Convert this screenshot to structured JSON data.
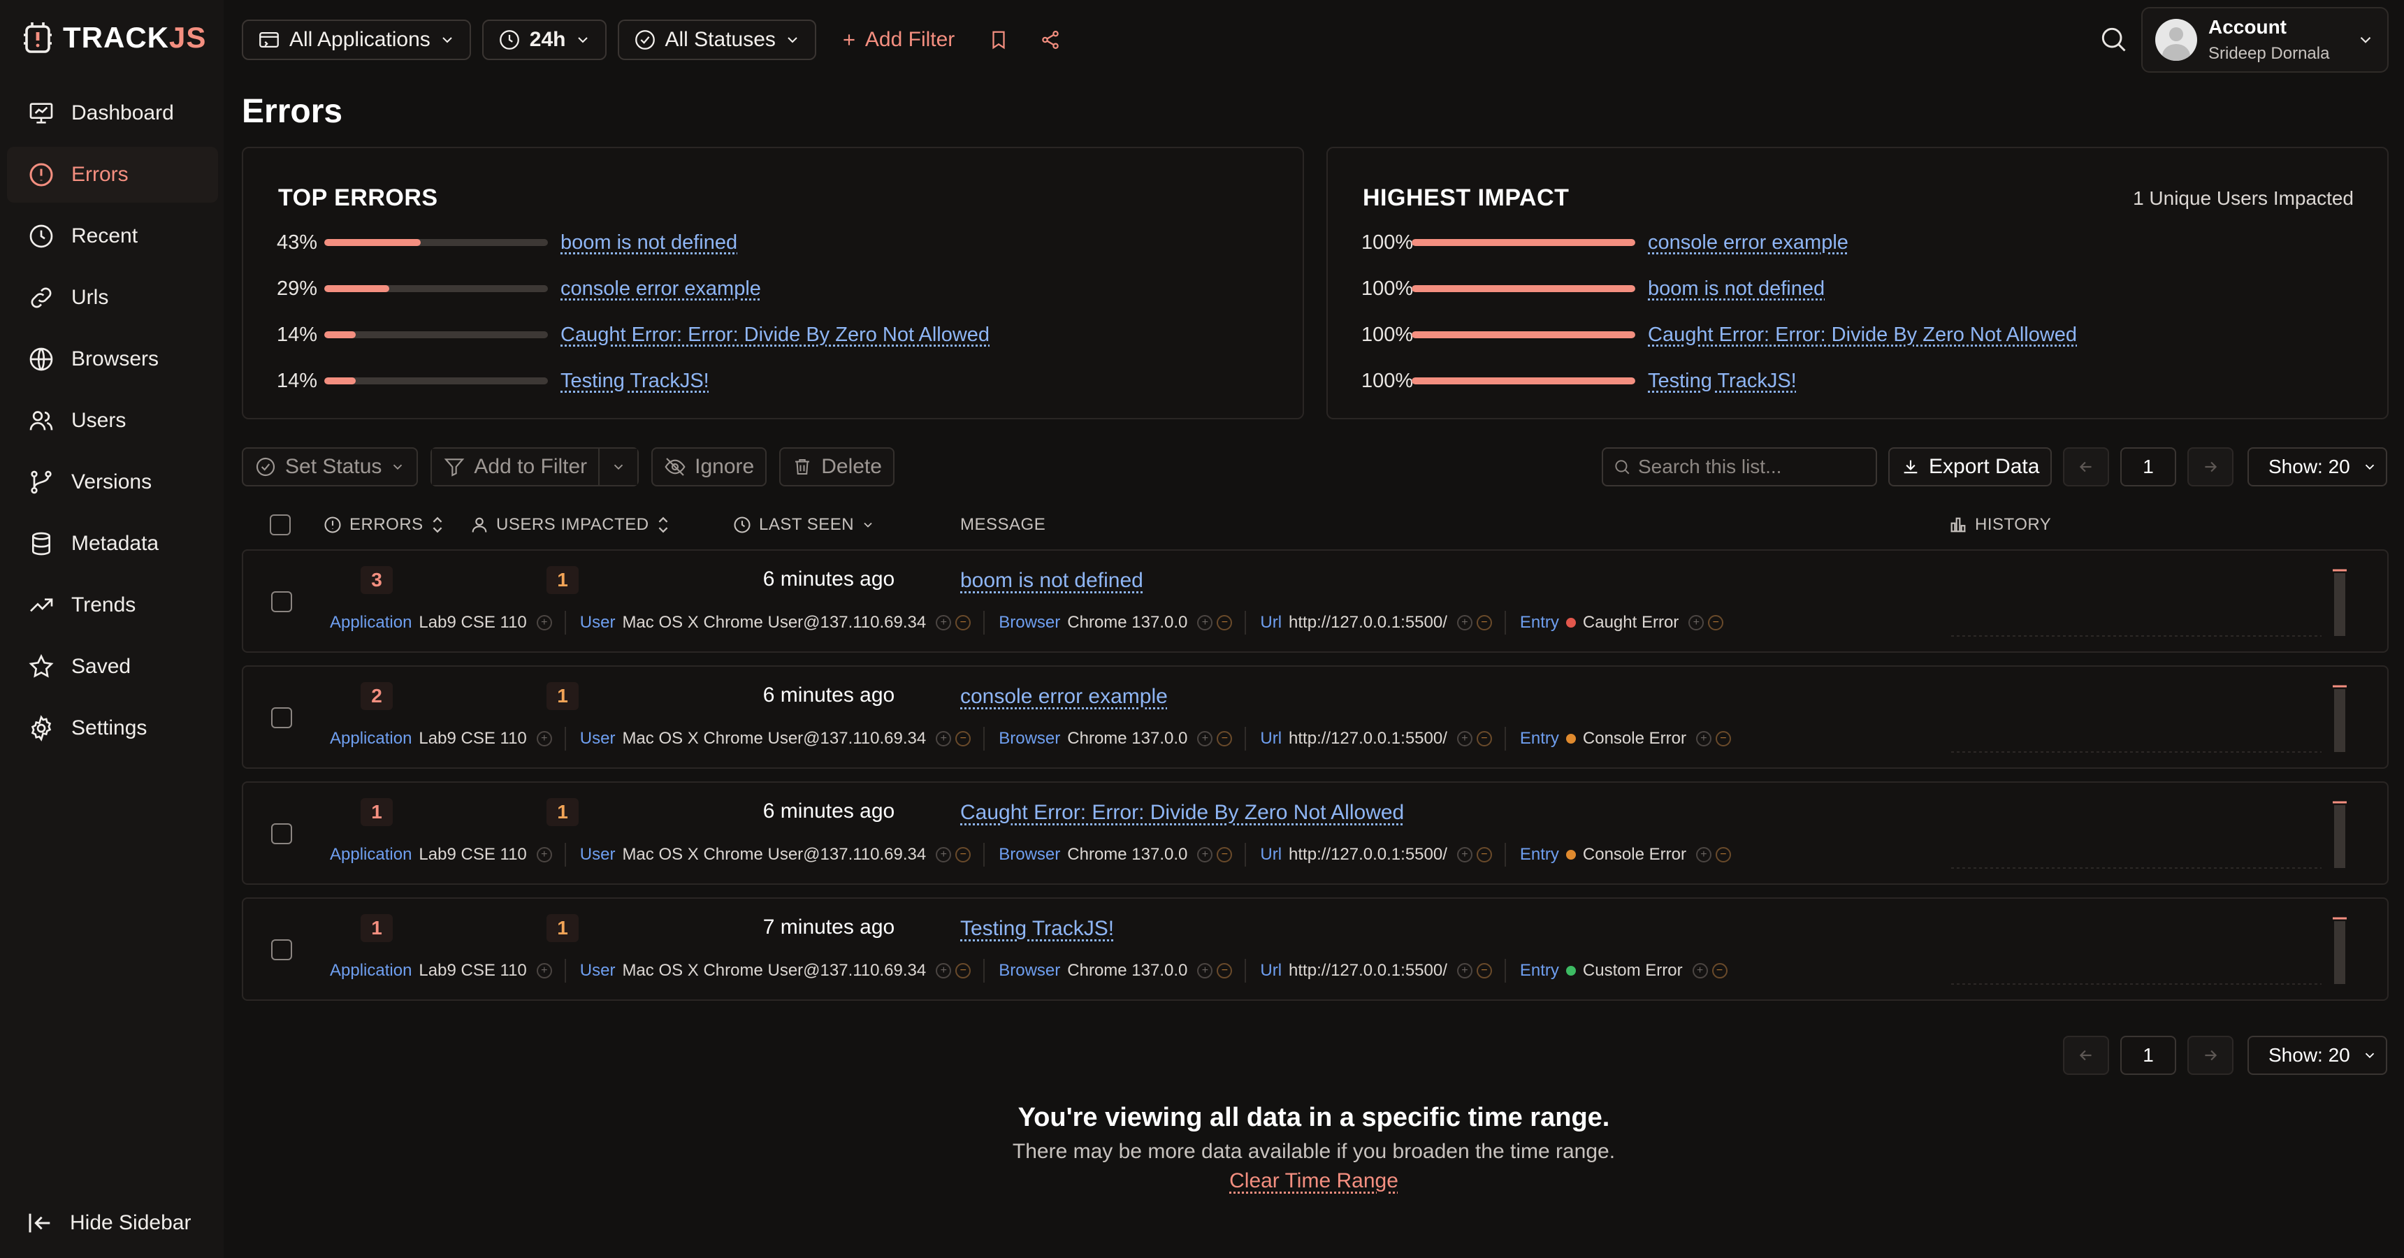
{
  "brand": {
    "logo_main": "TRACK",
    "logo_accent": "JS"
  },
  "sidebar": {
    "items": [
      {
        "label": "Dashboard",
        "icon": "dashboard-icon"
      },
      {
        "label": "Errors",
        "icon": "alert-circle-icon"
      },
      {
        "label": "Recent",
        "icon": "clock-icon"
      },
      {
        "label": "Urls",
        "icon": "link-icon"
      },
      {
        "label": "Browsers",
        "icon": "globe-icon"
      },
      {
        "label": "Users",
        "icon": "users-icon"
      },
      {
        "label": "Versions",
        "icon": "branch-icon"
      },
      {
        "label": "Metadata",
        "icon": "database-icon"
      },
      {
        "label": "Trends",
        "icon": "trend-icon"
      },
      {
        "label": "Saved",
        "icon": "star-icon"
      },
      {
        "label": "Settings",
        "icon": "gear-icon"
      }
    ],
    "active": "Errors",
    "hide_label": "Hide Sidebar"
  },
  "topbar": {
    "applications": "All Applications",
    "range": "24h",
    "statuses": "All Statuses",
    "add_filter": "Add Filter"
  },
  "account": {
    "title": "Account",
    "name": "Srideep Dornala"
  },
  "page_title": "Errors",
  "top_errors": {
    "title": "TOP ERRORS",
    "items": [
      {
        "pct": "43%",
        "value": 0.43,
        "label": "boom is not defined"
      },
      {
        "pct": "29%",
        "value": 0.29,
        "label": "console error example"
      },
      {
        "pct": "14%",
        "value": 0.14,
        "label": "Caught Error: Error: Divide By Zero Not Allowed"
      },
      {
        "pct": "14%",
        "value": 0.14,
        "label": "Testing TrackJS!"
      }
    ]
  },
  "highest_impact": {
    "title": "HIGHEST IMPACT",
    "note": "1 Unique Users Impacted",
    "items": [
      {
        "pct": "100%",
        "value": 1.0,
        "label": "console error example"
      },
      {
        "pct": "100%",
        "value": 1.0,
        "label": "boom is not defined"
      },
      {
        "pct": "100%",
        "value": 1.0,
        "label": "Caught Error: Error: Divide By Zero Not Allowed"
      },
      {
        "pct": "100%",
        "value": 1.0,
        "label": "Testing TrackJS!"
      }
    ]
  },
  "toolbar": {
    "set_status": "Set Status",
    "add_to_filter": "Add to Filter",
    "ignore": "Ignore",
    "delete": "Delete",
    "search_placeholder": "Search this list...",
    "export": "Export Data",
    "page": "1",
    "show": "Show: 20"
  },
  "table": {
    "headers": {
      "errors": "ERRORS",
      "users": "USERS IMPACTED",
      "last_seen": "LAST SEEN",
      "message": "MESSAGE",
      "history": "HISTORY"
    },
    "meta_keys": {
      "application": "Application",
      "user": "User",
      "browser": "Browser",
      "url": "Url",
      "entry": "Entry"
    },
    "rows": [
      {
        "errors": "3",
        "users": "1",
        "last_seen": "6 minutes ago",
        "message": "boom is not defined",
        "application": "Lab9 CSE 110",
        "user": "Mac OS X Chrome User@137.110.69.34",
        "browser": "Chrome 137.0.0",
        "url": "http://127.0.0.1:5500/",
        "entry": "Caught Error",
        "entry_color": "#e2574c"
      },
      {
        "errors": "2",
        "users": "1",
        "last_seen": "6 minutes ago",
        "message": "console error example",
        "application": "Lab9 CSE 110",
        "user": "Mac OS X Chrome User@137.110.69.34",
        "browser": "Chrome 137.0.0",
        "url": "http://127.0.0.1:5500/",
        "entry": "Console Error",
        "entry_color": "#e08a2e"
      },
      {
        "errors": "1",
        "users": "1",
        "last_seen": "6 minutes ago",
        "message": "Caught Error: Error: Divide By Zero Not Allowed",
        "application": "Lab9 CSE 110",
        "user": "Mac OS X Chrome User@137.110.69.34",
        "browser": "Chrome 137.0.0",
        "url": "http://127.0.0.1:5500/",
        "entry": "Console Error",
        "entry_color": "#e08a2e"
      },
      {
        "errors": "1",
        "users": "1",
        "last_seen": "7 minutes ago",
        "message": "Testing TrackJS!",
        "application": "Lab9 CSE 110",
        "user": "Mac OS X Chrome User@137.110.69.34",
        "browser": "Chrome 137.0.0",
        "url": "http://127.0.0.1:5500/",
        "entry": "Custom Error",
        "entry_color": "#3dbb63"
      }
    ]
  },
  "bottom": {
    "title": "You're viewing all data in a specific time range.",
    "subtitle": "There may be more data available if you broaden the time range.",
    "link": "Clear Time Range"
  },
  "colors": {
    "accent": "#f48f80",
    "link": "#8fb6f5",
    "meta_key": "#6f9ff0",
    "background": "#121110"
  }
}
